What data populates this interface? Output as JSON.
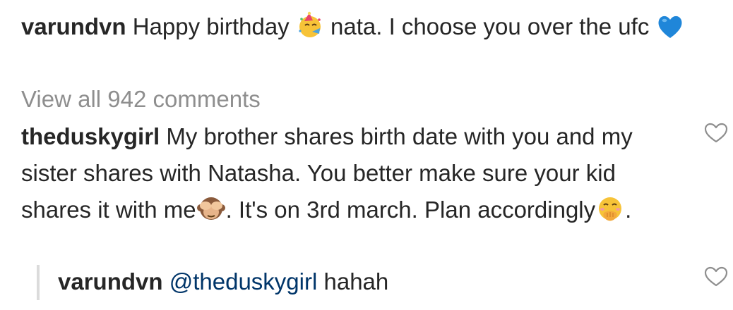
{
  "caption": {
    "username": "varundvn",
    "text_before": "Happy birthday",
    "text_after": "nata. I choose you over the ufc",
    "emoji_1": "partying-face",
    "emoji_2": "blue-heart"
  },
  "view_all_comments": "View all 942 comments",
  "comment": {
    "username": "theduskygirl",
    "text_part1": "My brother shares birth date with you and my sister shares with Natasha. You better make sure your kid shares it with me",
    "text_part2": ". It's on 3rd march. Plan accordingly",
    "text_part3": ".",
    "emoji_1": "see-no-evil-monkey",
    "emoji_2": "hand-over-mouth"
  },
  "reply": {
    "username": "varundvn",
    "mention": "@theduskygirl",
    "text": "hahah"
  },
  "colors": {
    "text": "#262626",
    "muted": "#8e8e8e",
    "mention": "#003569",
    "reply_bar": "#dbdbdb"
  }
}
